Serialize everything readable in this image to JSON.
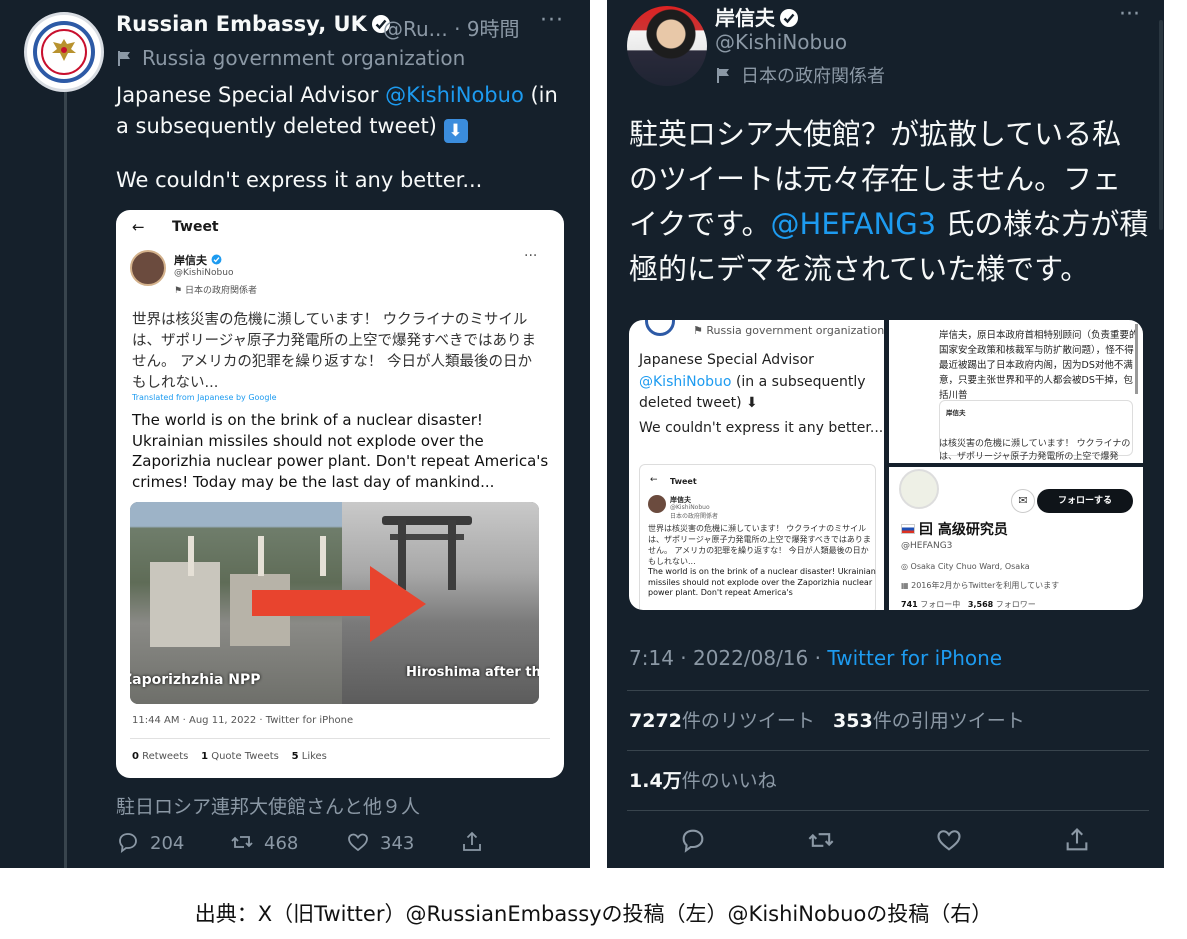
{
  "left": {
    "account_name": "Russian Embassy, UK",
    "handle_time": "@Ru... · 9時間",
    "more": "···",
    "org_label": "Russia government organization",
    "body_prefix": "Japanese Special Advisor ",
    "body_mention": "@KishiNobuo",
    "body_suffix": " (in a subsequently deleted tweet) ",
    "body_emoji": "⬇",
    "body_line2": "We couldn't express it any better...",
    "embed": {
      "back": "←",
      "title": "Tweet",
      "name": "岸信夫",
      "handle": "@KishiNobuo",
      "org": "日本の政府関係者",
      "more": "···",
      "jp_text": "世界は核災害の危機に瀕しています！ ウクライナのミサイルは、ザポリージャ原子力発電所の上空で爆発すべきではありません。 アメリカの犯罪を繰り返すな！ 今日が人類最後の日かもしれない...",
      "translated": "Translated from Japanese by Google",
      "en_text": "The world is on the brink of a nuclear disaster! Ukrainian missiles should not explode over the Zaporizhia nuclear power plant. Don't repeat America's crimes! Today may be the last day of mankind...",
      "photo_label_left": "Zaporizhzhia NPP",
      "photo_label_right": "Hiroshima after the a bomb explosio",
      "timestamp": "11:44 AM · Aug 11, 2022 · Twitter for iPhone",
      "retweets_count": "0",
      "retweets_label": "Retweets",
      "quotes_count": "1",
      "quotes_label": "Quote Tweets",
      "likes_count": "5",
      "likes_label": "Likes"
    },
    "liked_by": "駐日ロシア連邦大使館さんと他９人",
    "reply_count": "204",
    "retweet_count": "468",
    "like_count": "343"
  },
  "right": {
    "name": "岸信夫",
    "handle": "@KishiNobuo",
    "org_label": "日本の政府関係者",
    "more": "···",
    "body_part1": "駐英ロシア大使館？が拡散している私のツイートは元々存在しません。フェイクです。",
    "body_mention": "@HEFANG3",
    "body_part2": " 氏の様な方が積極的にデマを流されていた様です。",
    "grid": {
      "g1_org": "Russia government organization",
      "g1_text_prefix": "Japanese Special Advisor ",
      "g1_text_mention": "@KishiNobuo",
      "g1_text_suffix": " (in a subsequently deleted tweet) ⬇",
      "g1_text2": "We couldn't express it any better...",
      "g1_card_back": "←",
      "g1_card_title": "Tweet",
      "g1_card_name": "岸信夫",
      "g1_card_handle": "@KishiNobuo",
      "g1_card_org": "日本の政府関係者",
      "g1_card_jp": "世界は核災害の危機に瀕しています！ ウクライナのミサイルは、ザポリージャ原子力発電所の上空で爆発すべきではありません。 アメリカの犯罪を繰り返すな！ 今日が人類最後の日かもしれない...",
      "g1_card_en": "The world is on the brink of a nuclear disaster! Ukrainian missiles should not explode over the Zaporizhia nuclear power plant. Don't repeat America's",
      "g2_text": "岸信夫，原日本政府首相特别顾问（负责重要的国家安全政策和核裁军与防扩散问题），怪不得最近被踢出了日本政府内阁，因为DS对他不满意，只要主张世界和平的人都会被DS干掉，包括川普",
      "g2_card_name": "岸信夫",
      "g2_jp": "は核災害の危機に瀕しています！ ウクライナのは、ザポリージャ原子力発電所の上空で爆発",
      "g3_mail": "✉",
      "g3_follow": "フォローする",
      "g3_name": "囙 高级研究员",
      "g3_handle": "@HEFANG3",
      "g3_location": "Osaka City Chuo Ward, Osaka",
      "g3_joined": "2016年2月からTwitterを利用しています",
      "g3_following_count": "741",
      "g3_following_label": "フォロー中",
      "g3_followers_count": "3,568",
      "g3_followers_label": "フォロワー"
    },
    "meta_time": "7:14 · 2022/08/16 · ",
    "meta_source": "Twitter for iPhone",
    "retweets_count": "7272",
    "retweets_label": "件のリツイート",
    "quotes_count": "353",
    "quotes_label": "件の引用ツイート",
    "likes_count": "1.4万",
    "likes_label": "件のいいね"
  },
  "caption": "出典：X（旧Twitter）@RussianEmbassyの投稿（左）@KishiNobuoの投稿（右）",
  "colors": {
    "background": "#15202b",
    "accent": "#1d9bf0",
    "muted": "#8b98a5"
  }
}
